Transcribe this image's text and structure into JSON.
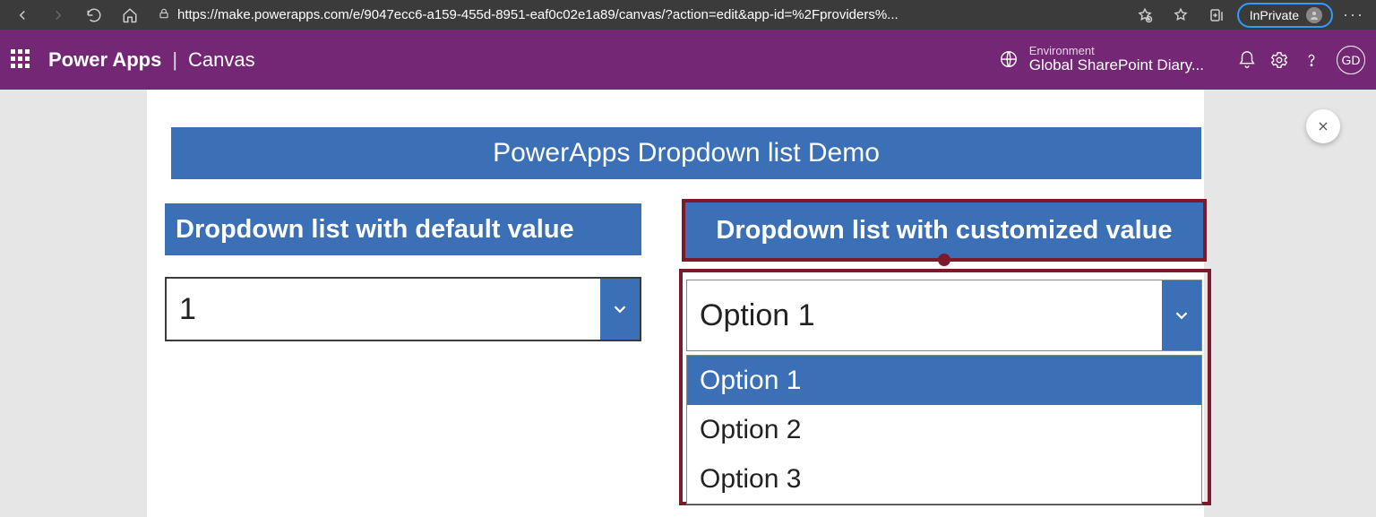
{
  "browser": {
    "url": "https://make.powerapps.com/e/9047ecc6-a159-455d-8951-eaf0c02e1a89/canvas/?action=edit&app-id=%2Fproviders%...",
    "inprivate_label": "InPrivate"
  },
  "header": {
    "app_name": "Power Apps",
    "separator": "|",
    "crumb": "Canvas",
    "env_label": "Environment",
    "env_name": "Global SharePoint Diary...",
    "avatar_initials": "GD"
  },
  "canvas": {
    "demo_title": "PowerApps Dropdown list Demo",
    "left_section_label": "Dropdown list with default value",
    "right_section_label": "Dropdown list with customized value",
    "left_dropdown_value": "1",
    "right_dropdown_value": "Option 1",
    "right_dropdown_options": [
      "Option 1",
      "Option 2",
      "Option 3"
    ]
  }
}
